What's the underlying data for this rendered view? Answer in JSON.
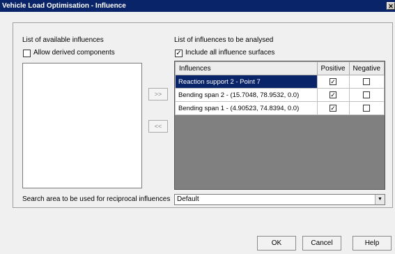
{
  "window": {
    "title": "Vehicle Load Optimisation - Influence",
    "close_glyph": "✕"
  },
  "left": {
    "heading": "List of available influences",
    "allow_derived_label": "Allow derived components",
    "allow_derived_checked": false,
    "add_button": ">>",
    "remove_button": "<<"
  },
  "right": {
    "heading": "List of influences to be analysed",
    "include_all_label": "Include all influence surfaces",
    "include_all_checked": true,
    "columns": {
      "influences": "Influences",
      "positive": "Positive",
      "negative": "Negative"
    },
    "rows": [
      {
        "name": "Reaction support 2 - Point 7",
        "positive": "✓",
        "negative": "",
        "selected": true
      },
      {
        "name": "Bending span 2 - (15.7048, 78.9532, 0.0)",
        "positive": "✓",
        "negative": ""
      },
      {
        "name": "Bending span 1 - (4.90523, 74.8394, 0.0)",
        "positive": "✓",
        "negative": ""
      }
    ]
  },
  "search": {
    "label": "Search area to be used for reciprocal influences",
    "value": "Default",
    "arrow": "▼"
  },
  "buttons": {
    "ok": "OK",
    "cancel": "Cancel",
    "help": "Help"
  },
  "check_glyph": "✓"
}
